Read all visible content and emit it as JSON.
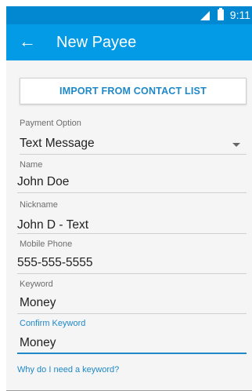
{
  "status_bar": {
    "time": "9:11"
  },
  "app_bar": {
    "title": "New Payee"
  },
  "import_button": {
    "label": "IMPORT FROM CONTACT LIST"
  },
  "payment_option": {
    "label": "Payment Option",
    "value": "Text Message"
  },
  "name": {
    "label": "Name",
    "value": "John Doe"
  },
  "nickname": {
    "label": "Nickname",
    "value": "John D - Text"
  },
  "mobile_phone": {
    "label": "Mobile Phone",
    "value": "555-555-5555"
  },
  "keyword": {
    "label": "Keyword",
    "value": "Money"
  },
  "confirm_keyword": {
    "label": "Confirm Keyword",
    "value": "Money"
  },
  "help_link": {
    "label": "Why do I need a keyword?"
  },
  "colors": {
    "app_bar": "#039be5",
    "status_bar": "#0288d1",
    "accent": "#1e88c8",
    "background": "#f5f5f5"
  }
}
